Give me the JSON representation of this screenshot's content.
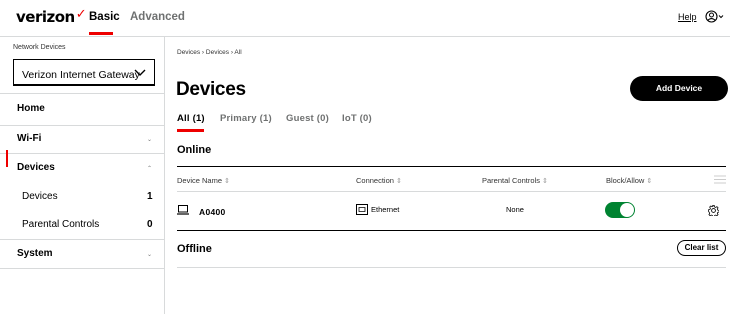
{
  "header": {
    "logo": "verizon",
    "logo_check": "✓",
    "tabs": [
      {
        "label": "Basic",
        "active": true
      },
      {
        "label": "Advanced",
        "active": false
      }
    ],
    "help_label": "Help",
    "user_menu_icon": "user-circle-icon"
  },
  "sidebar": {
    "network_devices_label": "Network Devices",
    "network_devices_value": "Verizon Internet Gateway",
    "items": [
      {
        "label": "Home"
      },
      {
        "label": "Wi-Fi",
        "chevron": "⌄"
      },
      {
        "label": "Devices",
        "chevron": "⌃"
      },
      {
        "label": "Devices",
        "count": "1",
        "active": true
      },
      {
        "label": "Parental Controls",
        "count": "0"
      },
      {
        "label": "System",
        "chevron": "⌄"
      }
    ]
  },
  "main": {
    "breadcrumb": "Devices  ›  Devices  ›  All",
    "title": "Devices",
    "add_button": "Add Device",
    "filters": [
      {
        "label": "All (1)",
        "active": true
      },
      {
        "label": "Primary (1)"
      },
      {
        "label": "Guest (0)"
      },
      {
        "label": "IoT (0)"
      }
    ],
    "online_heading": "Online",
    "columns": [
      "Device Name",
      "Connection",
      "Parental Controls",
      "Block/Allow"
    ],
    "sort_glyph": "⇕",
    "rows": [
      {
        "name": "A0400",
        "connection": "Ethernet",
        "parental_controls": "None",
        "block_allow": "allowed"
      }
    ],
    "offline_heading": "Offline",
    "clear_button": "Clear list"
  },
  "colors": {
    "accent": "#ee0000",
    "toggle_on": "#008331",
    "button_dark": "#000000"
  }
}
